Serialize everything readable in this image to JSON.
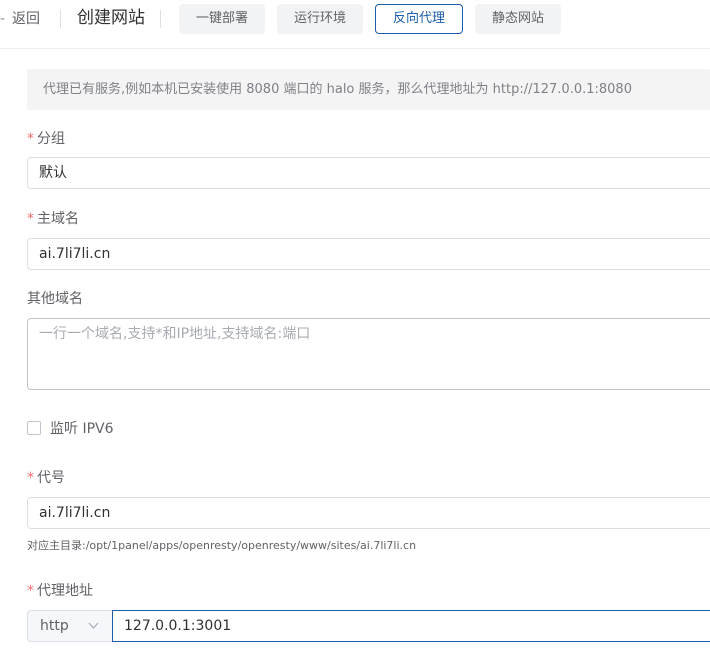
{
  "header": {
    "back_label": "返回",
    "title": "创建网站",
    "tabs": [
      {
        "label": "一键部署",
        "active": false
      },
      {
        "label": "运行环境",
        "active": false
      },
      {
        "label": "反向代理",
        "active": true
      },
      {
        "label": "静态网站",
        "active": false
      }
    ]
  },
  "notice": {
    "text": "代理已有服务,例如本机已安装使用 8080 端口的 halo 服务，那么代理地址为 http://127.0.0.1:8080"
  },
  "form": {
    "required_mark": "*",
    "group": {
      "label": "分组",
      "value": "默认"
    },
    "primary_domain": {
      "label": "主域名",
      "value": "ai.7li7li.cn"
    },
    "other_domains": {
      "label": "其他域名",
      "placeholder": "一行一个域名,支持*和IP地址,支持域名:端口"
    },
    "ipv6": {
      "label": "监听 IPV6",
      "checked": false
    },
    "alias": {
      "label": "代号",
      "value": "ai.7li7li.cn",
      "hint": "对应主目录:/opt/1panel/apps/openresty/openresty/www/sites/ai.7li7li.cn"
    },
    "proxy": {
      "label": "代理地址",
      "scheme": "http",
      "address": "127.0.0.1:3001"
    }
  },
  "colors": {
    "accent": "#1c5dab",
    "required": "#f56c6c",
    "notice_bg": "#f4f4f5"
  }
}
